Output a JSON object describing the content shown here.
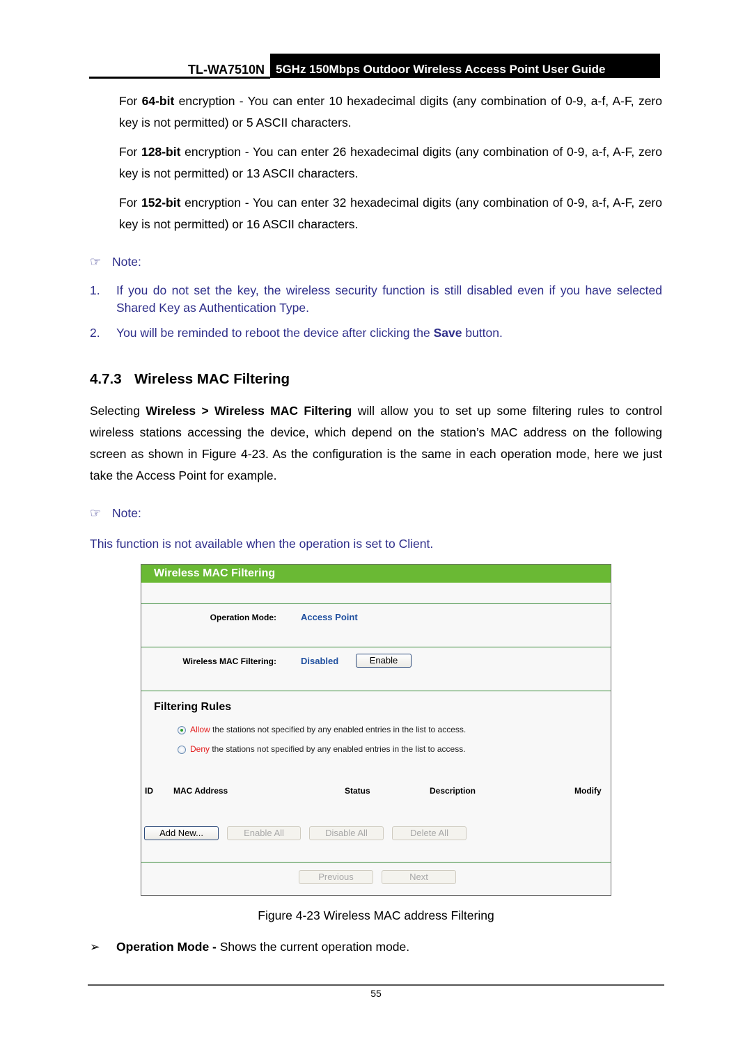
{
  "header": {
    "model": "TL-WA7510N",
    "title": "5GHz 150Mbps Outdoor Wireless Access Point User Guide"
  },
  "encryption": [
    {
      "prefix": "For ",
      "bold": "64-bit",
      "text": " encryption - You can enter 10 hexadecimal digits (any combination of 0-9, a-f, A-F, zero key is not permitted) or 5 ASCII characters."
    },
    {
      "prefix": "For ",
      "bold": "128-bit",
      "text": " encryption - You can enter 26 hexadecimal digits (any combination of 0-9, a-f, A-F, zero key is not permitted) or 13 ASCII characters."
    },
    {
      "prefix": "For ",
      "bold": "152-bit",
      "text": " encryption - You can enter 32 hexadecimal digits (any combination of 0-9, a-f, A-F, zero key is not permitted) or 16 ASCII characters."
    }
  ],
  "note1": {
    "icon": "pointing-hand-icon",
    "label": "Note:",
    "items": [
      {
        "num": "1.",
        "text": "If you do not set the key, the wireless security function is still disabled even if you have selected Shared Key as Authentication Type."
      },
      {
        "num": "2.",
        "pre": "You will be reminded to reboot the device after clicking the ",
        "bold": "Save",
        "post": " button."
      }
    ]
  },
  "section": {
    "number": "4.7.3",
    "title": "Wireless MAC Filtering",
    "para_pre": "Selecting ",
    "para_bold": "Wireless > Wireless MAC Filtering",
    "para_post": " will allow you to set up some filtering rules to control wireless stations accessing the device, which depend on the station’s MAC address on the following screen as shown in Figure 4-23. As the configuration is the same in each operation mode, here we just take the Access Point for example."
  },
  "note2": {
    "icon": "pointing-hand-icon",
    "label": "Note:",
    "text": "This function is not available when the operation is set to Client."
  },
  "figure": {
    "title": "Wireless MAC Filtering",
    "operation_mode_label": "Operation Mode:",
    "operation_mode_value": "Access Point",
    "filtering_label": "Wireless MAC Filtering:",
    "filtering_value": "Disabled",
    "enable_button": "Enable",
    "rules_title": "Filtering Rules",
    "rules": [
      {
        "keyword": "Allow",
        "text": " the stations not specified by any enabled entries in the list to access.",
        "checked": true
      },
      {
        "keyword": "Deny",
        "text": " the stations not specified by any enabled entries in the list to access.",
        "checked": false
      }
    ],
    "columns": [
      "ID",
      "MAC Address",
      "Status",
      "Description",
      "Modify"
    ],
    "buttons": {
      "add_new": "Add New...",
      "enable_all": "Enable All",
      "disable_all": "Disable All",
      "delete_all": "Delete All",
      "previous": "Previous",
      "next": "Next"
    },
    "accent": "#6ab934"
  },
  "caption": "Figure 4-23 Wireless MAC address Filtering",
  "bullet": {
    "icon": "arrowhead-bullet-icon",
    "bold": "Operation Mode -",
    "text": " Shows the current operation mode."
  },
  "page_number": "55"
}
